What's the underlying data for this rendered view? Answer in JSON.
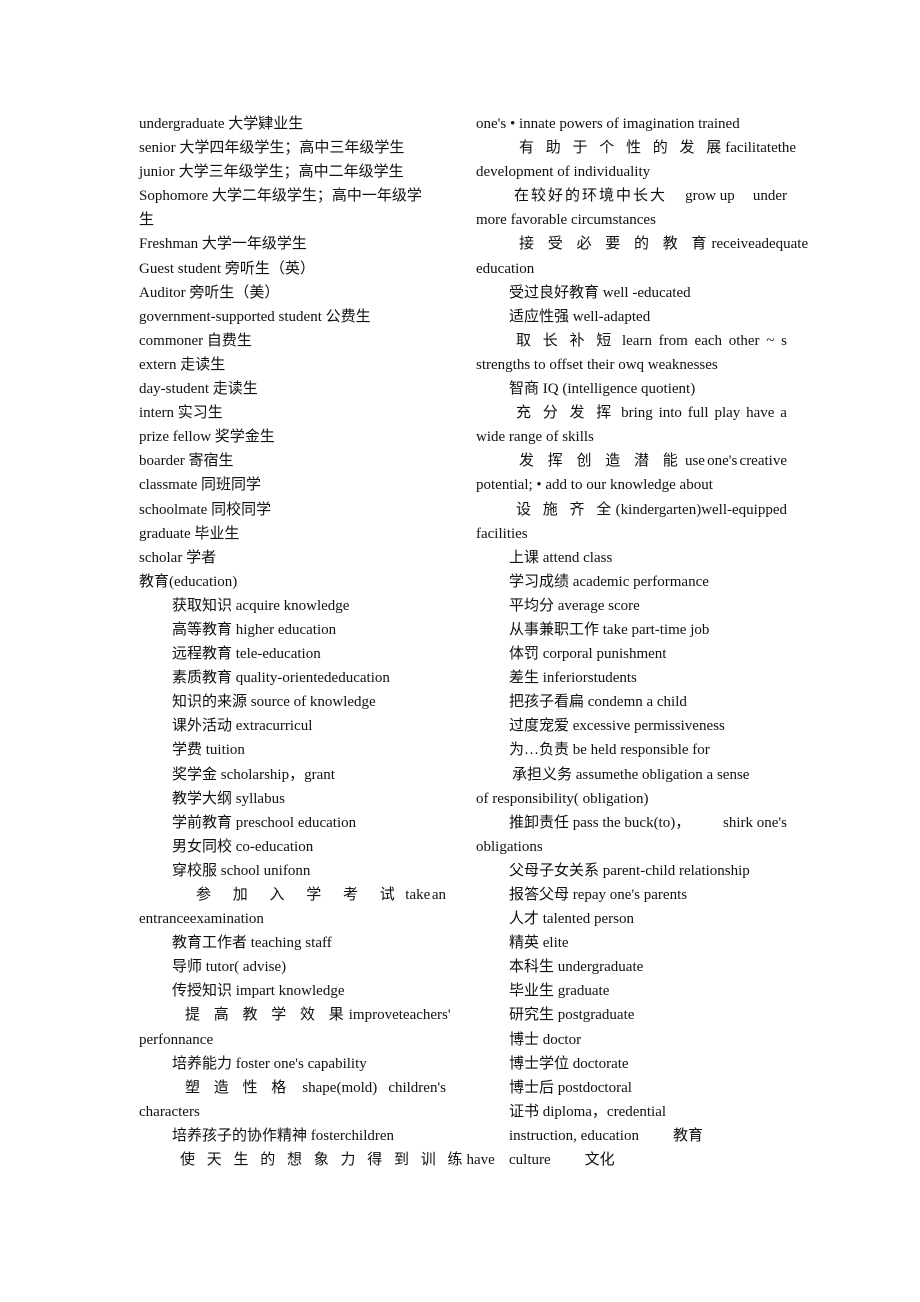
{
  "left_column": {
    "lines": [
      "undergraduate  大学肄业生",
      "senior  大学四年级学生；高中三年级学生",
      "junior  大学三年级学生；高中二年级学生",
      "Sophomore  大学二年级学生；高中一年级学",
      "生",
      "Freshman  大学一年级学生",
      "Guest student  旁听生（英）",
      "Auditor  旁听生（美）",
      "government-supported student  公费生",
      "commoner  自费生",
      "extern  走读生",
      "day-student  走读生",
      "intern  实习生",
      "prize fellow  奖学金生",
      "boarder  寄宿生",
      "classmate  同班同学",
      "schoolmate  同校同学",
      "graduate  毕业生",
      "scholar  学者",
      "教育(education)"
    ],
    "indented": [
      "获取知识  acquire knowledge",
      "高等教育  higher education",
      "远程教育  tele-education",
      "素质教育  quality-orientededucation",
      "知识的来源  source of knowledge",
      "课外活动  extracurricul",
      "学费  tuition",
      "奖学金  scholarship，grant",
      "教学大纲  syllabus",
      "学前教育  preschool education",
      "男女同校  co-education",
      "穿校服  school unifonn"
    ],
    "entrance": {
      "zh": "参 加 入 学 考 试",
      "en1": "take",
      "en2": "an",
      "cont": "entranceexamination"
    },
    "indented2": [
      "教育工作者  teaching staff",
      "导师  tutor( advise)",
      "传授知识  impart knowledge"
    ],
    "improve": {
      "zh": "提 高 教 学 效 果",
      "en": "improveteachers'",
      "cont": "perfonnance"
    },
    "foster": "培养能力  foster one's capability",
    "shape": {
      "zh": "塑 造 性 格",
      "en1": "shape(mold)",
      "en2": "children's",
      "cont": "characters"
    },
    "cooperate": "培养孩子的协作精神  fosterchildren",
    "imagination": {
      "zh": "使 天 生 的 想 象 力 得 到 训 练",
      "en": "have"
    }
  },
  "right_column": {
    "first": "one's •   innate powers of imagination trained",
    "individuality": {
      "zh": "有 助 于 个 性 的 发 展",
      "en1": "facilitate",
      "en2": "the",
      "cont": "development of individuality"
    },
    "environment": {
      "zh": "在较好的环境中长大",
      "en1": "grow up",
      "en2": "under",
      "cont": "more favorable circumstances"
    },
    "adequate": {
      "zh": "接 受 必 要 的 教 育",
      "en1": "receive",
      "en2": "adequate",
      "cont": "education"
    },
    "simple1": [
      "受过良好教育  well -educated",
      "适应性强  well-adapted"
    ],
    "learn": {
      "zh": "取 长 补 短",
      "en": [
        "learn",
        "from",
        "each",
        "other",
        "~",
        "s"
      ],
      "cont": "strengths to offset their owq weaknesses"
    },
    "iq": "智商 IQ (intelligence quotient)",
    "play": {
      "zh": "充 分 发 挥",
      "en": [
        "bring",
        "into",
        "full",
        "play",
        "have",
        "a"
      ],
      "cont": "wide range of skills"
    },
    "creative": {
      "zh": "发 挥 创 造 潜 能",
      "en": [
        "use",
        "one's",
        "creative"
      ],
      "cont": "potential; •   add to our knowledge about"
    },
    "facilities": {
      "zh": "设 施 齐 全",
      "en": "(kindergarten)well-equipped",
      "cont": "facilities"
    },
    "simple2": [
      "上课  attend class",
      "学习成绩  academic performance",
      "平均分  average score",
      "从事兼职工作  take part-time job",
      "体罚  corporal punishment",
      "差生  inferiorstudents",
      "把孩子看扁  condemn a child",
      "过度宠爱  excessive permissiveness",
      "为…负责  be held responsible for"
    ],
    "obligation": {
      "text": "承担义务  assumethe obligation a sense",
      "cont": "of responsibility( obligation)"
    },
    "buck": {
      "zh": "推卸责任  pass the buck(to)，",
      "en": "shirk one's",
      "cont": "obligations"
    },
    "simple3": [
      "父母子女关系  parent-child relationship",
      "报答父母  repay one's parents",
      "人才  talented person",
      "精英  elite",
      "本科生  undergraduate",
      "毕业生  graduate",
      "研究生  postgraduate",
      "博士  doctor",
      "博士学位  doctorate",
      "博士后  postdoctoral",
      "证书  diploma，credential"
    ],
    "instruction": {
      "en": "instruction, education",
      "zh": "教育"
    },
    "culture": {
      "en": "culture",
      "zh": "文化"
    }
  }
}
